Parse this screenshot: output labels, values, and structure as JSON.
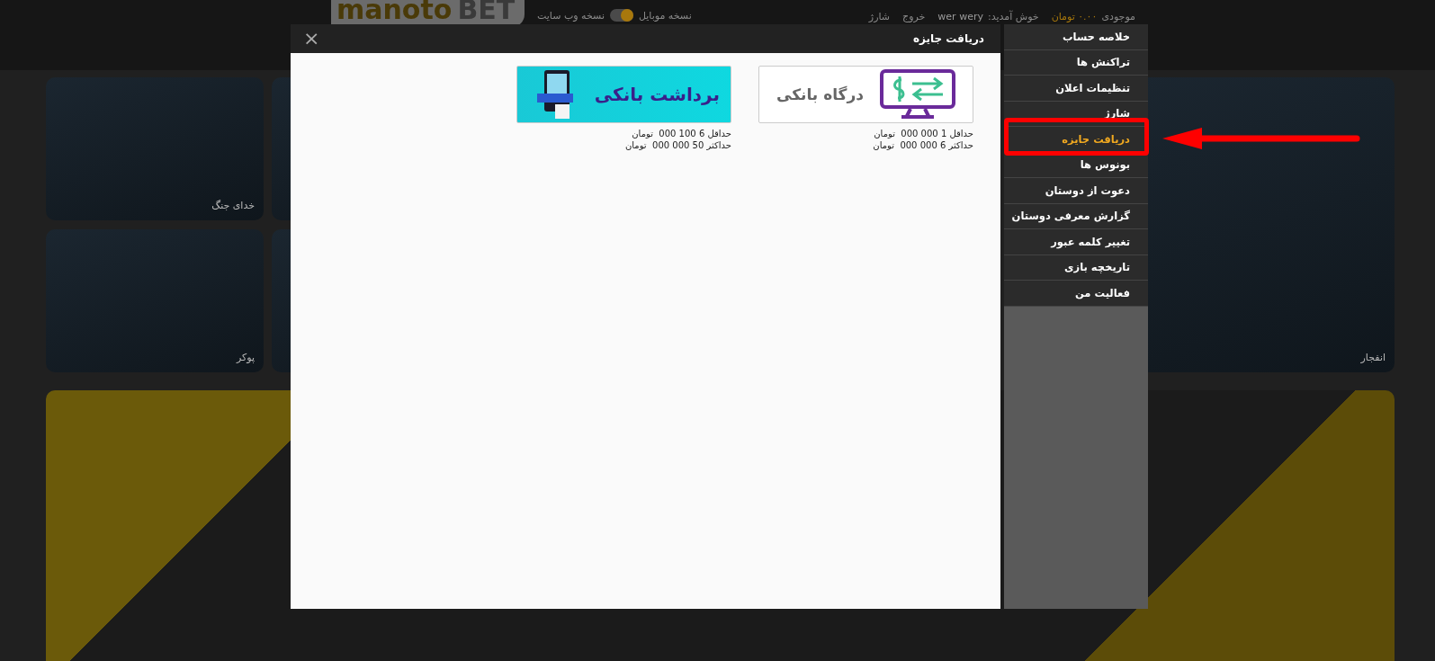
{
  "header": {
    "logo": {
      "part_1": "manoto",
      "part_2": "BET"
    },
    "version_switch": {
      "label_web": "نسخه وب سایت",
      "label_mobile": "نسخه موبایل",
      "on": true
    },
    "account": {
      "balance_label": "موجودی",
      "balance": "۰.۰۰ تومان",
      "welcome": "خوش آمدید:",
      "user": "wer wery",
      "links": [
        "خروج",
        "شارژ"
      ]
    }
  },
  "games": [
    {
      "caption": "خدای جنگ",
      "kind": "coin"
    },
    {
      "caption": "پوکر",
      "kind": "poker"
    },
    {
      "caption": "انفجار",
      "kind": "crash"
    }
  ],
  "modal": {
    "title": "دریافت جایزه",
    "close": "×",
    "payment_methods": [
      {
        "kind": "gateway",
        "banner_text": "درگاه بانکی",
        "min": "حداقل 1 000 000  تومان",
        "max": "حداکثر 6 000 000  تومان"
      },
      {
        "kind": "withdraw",
        "banner_text": "برداشت بانکی",
        "min": "حداقل 6 100 000  تومان",
        "max": "حداکثر 50 000 000  تومان"
      }
    ]
  },
  "menu": [
    {
      "label": "خلاصه حساب",
      "selected": false
    },
    {
      "label": "تراکنش ها",
      "selected": false
    },
    {
      "label": "تنظیمات اعلان",
      "selected": false
    },
    {
      "label": "شارژ",
      "selected": false
    },
    {
      "label": "دریافت جایزه",
      "selected": true
    },
    {
      "label": "بونوس ها",
      "selected": false
    },
    {
      "label": "دعوت از دوستان",
      "selected": false
    },
    {
      "label": "گزارش معرفی دوستان",
      "selected": false
    },
    {
      "label": "تغییر کلمه عبور",
      "selected": false
    },
    {
      "label": "تاریخچه بازی",
      "selected": false
    },
    {
      "label": "فعالیت من",
      "selected": false
    }
  ]
}
